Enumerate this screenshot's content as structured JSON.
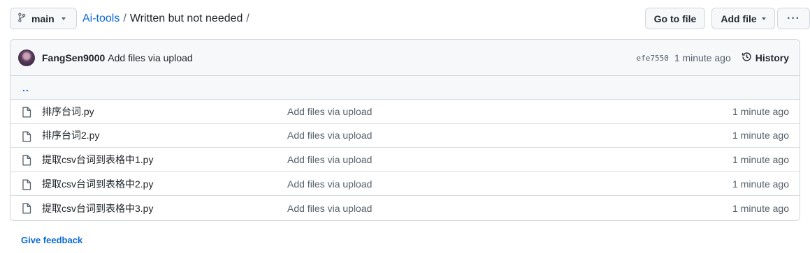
{
  "header": {
    "branch_label": "main",
    "breadcrumb_repo": "Ai-tools",
    "breadcrumb_sep": "/",
    "breadcrumb_dir": "Written but not needed",
    "breadcrumb_trailing_sep": "/",
    "goto_file_label": "Go to file",
    "add_file_label": "Add file",
    "more_label": "···"
  },
  "commit": {
    "author": "FangSen9000",
    "message": "Add files via upload",
    "sha": "efe7550",
    "time": "1 minute ago",
    "history_label": "History"
  },
  "parent_link": "..",
  "files": [
    {
      "name": "排序台词.py",
      "message": "Add files via upload",
      "time": "1 minute ago"
    },
    {
      "name": "排序台词2.py",
      "message": "Add files via upload",
      "time": "1 minute ago"
    },
    {
      "name": "提取csv台词到表格中1.py",
      "message": "Add files via upload",
      "time": "1 minute ago"
    },
    {
      "name": "提取csv台词到表格中2.py",
      "message": "Add files via upload",
      "time": "1 minute ago"
    },
    {
      "name": "提取csv台词到表格中3.py",
      "message": "Add files via upload",
      "time": "1 minute ago"
    }
  ],
  "feedback_label": "Give feedback",
  "icons": {
    "branch": "git-branch-icon",
    "file": "file-icon",
    "history": "history-clock-icon"
  },
  "colors": {
    "link": "#0969da",
    "muted": "#57606a",
    "border": "#d0d7de",
    "header_bg": "#f6f8fa"
  }
}
